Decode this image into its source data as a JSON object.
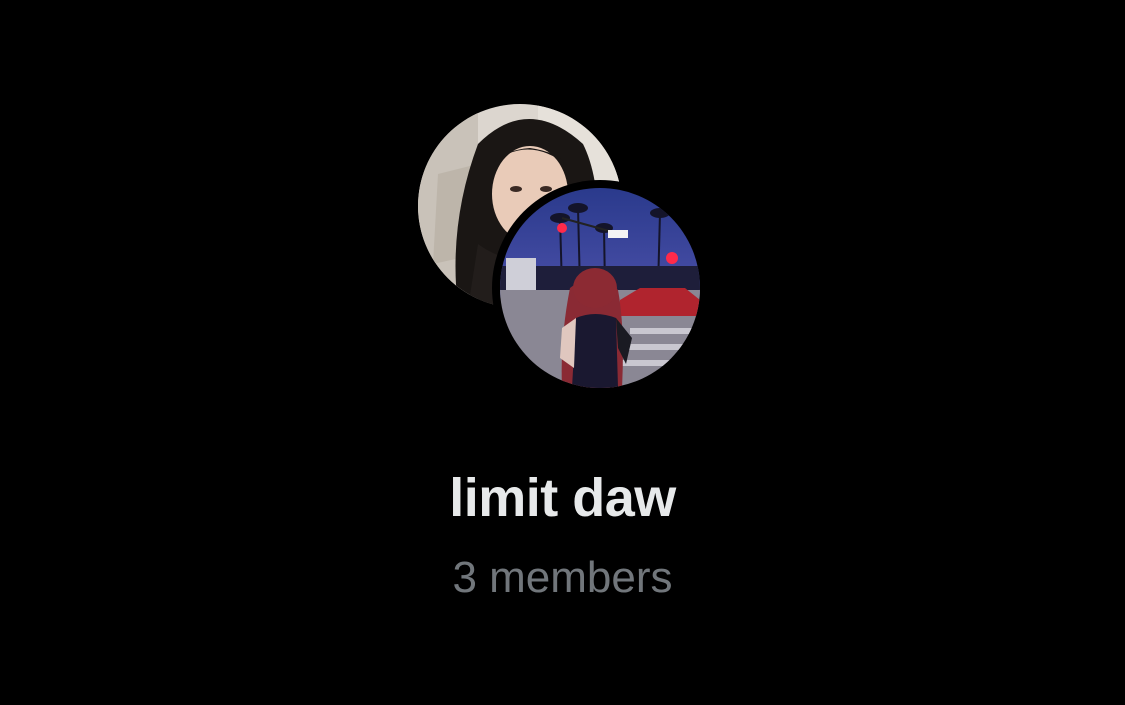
{
  "group": {
    "name": "limit daw",
    "member_count_label": "3 members",
    "avatars": [
      {
        "icon": "selfie-photo-avatar"
      },
      {
        "icon": "street-night-photo-avatar"
      }
    ]
  },
  "colors": {
    "background": "#000000",
    "title": "#e7e9ea",
    "subtitle": "#71767b"
  }
}
